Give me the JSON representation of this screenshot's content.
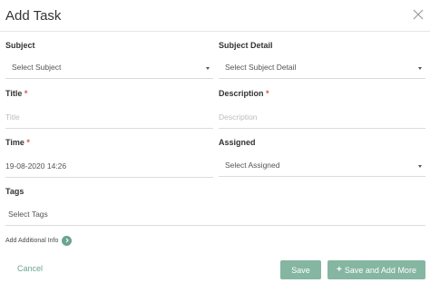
{
  "dialog": {
    "title": "Add Task"
  },
  "form": {
    "subject": {
      "label": "Subject",
      "placeholder": "Select Subject"
    },
    "subject_detail": {
      "label": "Subject Detail",
      "placeholder": "Select Subject Detail"
    },
    "title": {
      "label": "Title",
      "required_mark": "*",
      "placeholder": "Title"
    },
    "description": {
      "label": "Description",
      "required_mark": "*",
      "placeholder": "Description"
    },
    "time": {
      "label": "Time",
      "required_mark": "*",
      "value": "19-08-2020 14:26"
    },
    "assigned": {
      "label": "Assigned",
      "placeholder": "Select Assigned"
    },
    "tags": {
      "label": "Tags",
      "placeholder": "Select Tags"
    },
    "additional_info": {
      "label": "Add Additional Info"
    }
  },
  "footer": {
    "cancel_label": "Cancel",
    "save_label": "Save",
    "save_more_label": "Save and Add More"
  },
  "colors": {
    "accent": "#6aa58e",
    "button_bg": "#85b6a2",
    "required": "#d9534f"
  }
}
